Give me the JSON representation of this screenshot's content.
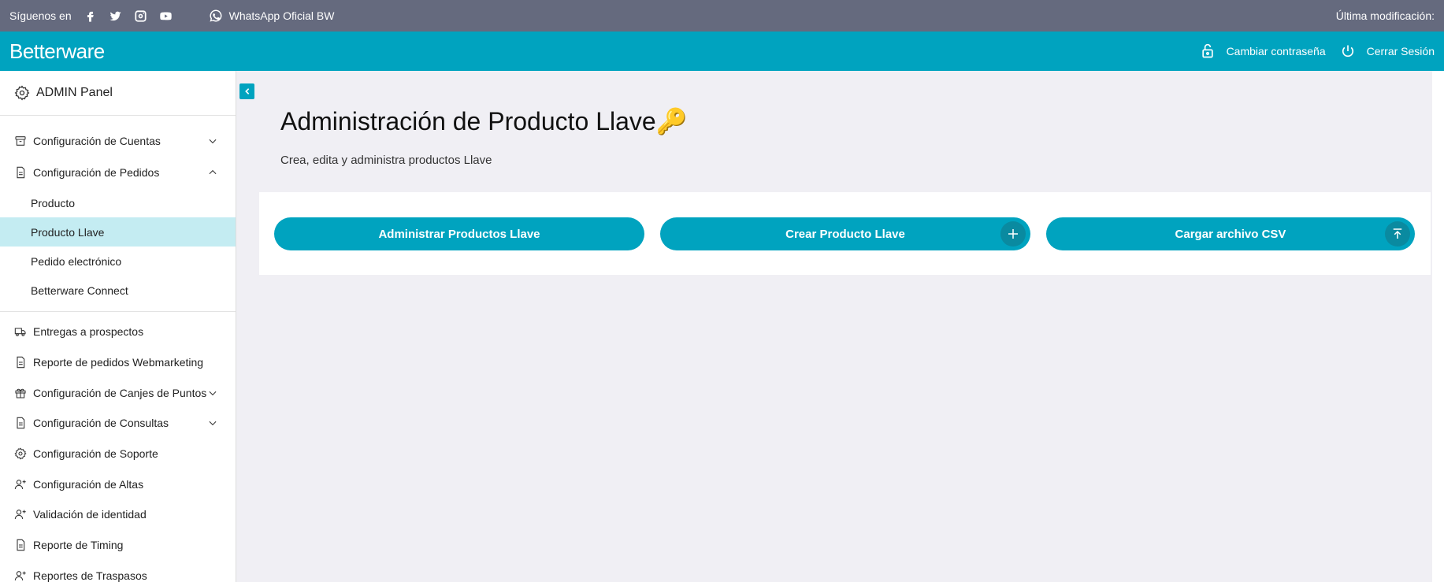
{
  "topbar": {
    "follow_label": "Síguenos en",
    "social_icons": [
      "facebook-icon",
      "twitter-icon",
      "instagram-icon",
      "youtube-icon"
    ],
    "whatsapp_label": "WhatsApp Oficial BW",
    "last_modified_label": "Última modificación:"
  },
  "header": {
    "logo_text": "Betterware",
    "change_password_label": "Cambiar contraseña",
    "logout_label": "Cerrar Sesión"
  },
  "sidebar": {
    "panel_title": "ADMIN Panel",
    "groups": [
      {
        "label": "Configuración de Cuentas",
        "icon": "archive-icon",
        "expanded": false
      },
      {
        "label": "Configuración de Pedidos",
        "icon": "document-icon",
        "expanded": true
      }
    ],
    "sub_items": [
      {
        "label": "Producto",
        "active": false
      },
      {
        "label": "Producto Llave",
        "active": true
      },
      {
        "label": "Pedido electrónico",
        "active": false
      },
      {
        "label": "Betterware Connect",
        "active": false
      }
    ],
    "items": [
      {
        "label": "Entregas a prospectos",
        "icon": "truck-icon"
      },
      {
        "label": "Reporte de pedidos Webmarketing",
        "icon": "document-icon"
      },
      {
        "label": "Configuración de Canjes de Puntos",
        "icon": "gift-icon"
      },
      {
        "label": "Configuración de Consultas",
        "icon": "document-icon"
      },
      {
        "label": "Configuración de Soporte",
        "icon": "gear-icon"
      },
      {
        "label": "Configuración de Altas",
        "icon": "user-plus-icon"
      },
      {
        "label": "Validación de identidad",
        "icon": "user-plus-icon"
      },
      {
        "label": "Reporte de Timing",
        "icon": "document-icon"
      },
      {
        "label": "Reportes de Traspasos",
        "icon": "user-plus-icon"
      }
    ]
  },
  "main": {
    "title": "Administración de Producto Llave🔑",
    "subtitle": "Crea, edita y administra productos Llave",
    "buttons": {
      "manage_label": "Administrar Productos Llave",
      "create_label": "Crear Producto Llave",
      "upload_label": "Cargar archivo CSV"
    }
  },
  "colors": {
    "topbar": "#656a7e",
    "brand": "#00a3bf",
    "active_item": "#c4ecf2",
    "main_bg": "#f0eff4"
  }
}
